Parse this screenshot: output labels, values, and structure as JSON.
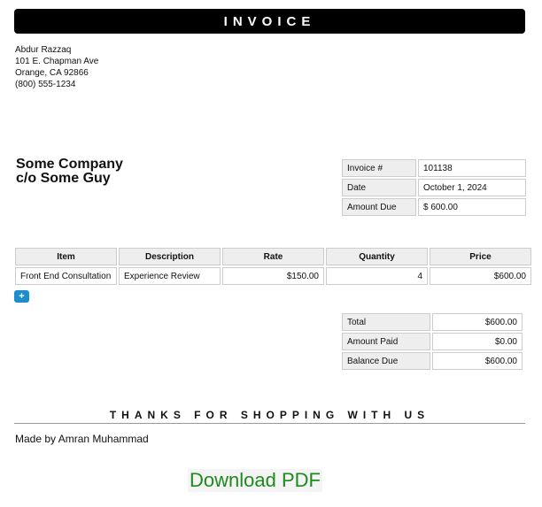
{
  "header": {
    "title": "INVOICE"
  },
  "seller": {
    "name": "Abdur Razzaq",
    "street": "101 E. Chapman Ave",
    "city": "Orange, CA 92866",
    "phone": "(800) 555-1234"
  },
  "customer": {
    "line1": "Some Company",
    "line2": "c/o Some Guy"
  },
  "meta": {
    "invoice_label": "Invoice #",
    "invoice_value": "101138",
    "date_label": "Date",
    "date_value": "October 1, 2024",
    "due_label": "Amount Due",
    "due_value": "$ 600.00"
  },
  "items": {
    "headers": [
      "Item",
      "Description",
      "Rate",
      "Quantity",
      "Price"
    ],
    "rows": [
      [
        "Front End Consultation",
        "Experience Review",
        "$150.00",
        "4",
        "$600.00"
      ]
    ],
    "add_label": "+"
  },
  "totals": {
    "total_label": "Total",
    "total_value": "$600.00",
    "paid_label": "Amount Paid",
    "paid_value": "$0.00",
    "balance_label": "Balance Due",
    "balance_value": "$600.00"
  },
  "footer": {
    "thanks": "THANKS FOR SHOPPING WITH US",
    "made_by": "Made by Amran Muhammad",
    "download": "Download PDF"
  }
}
